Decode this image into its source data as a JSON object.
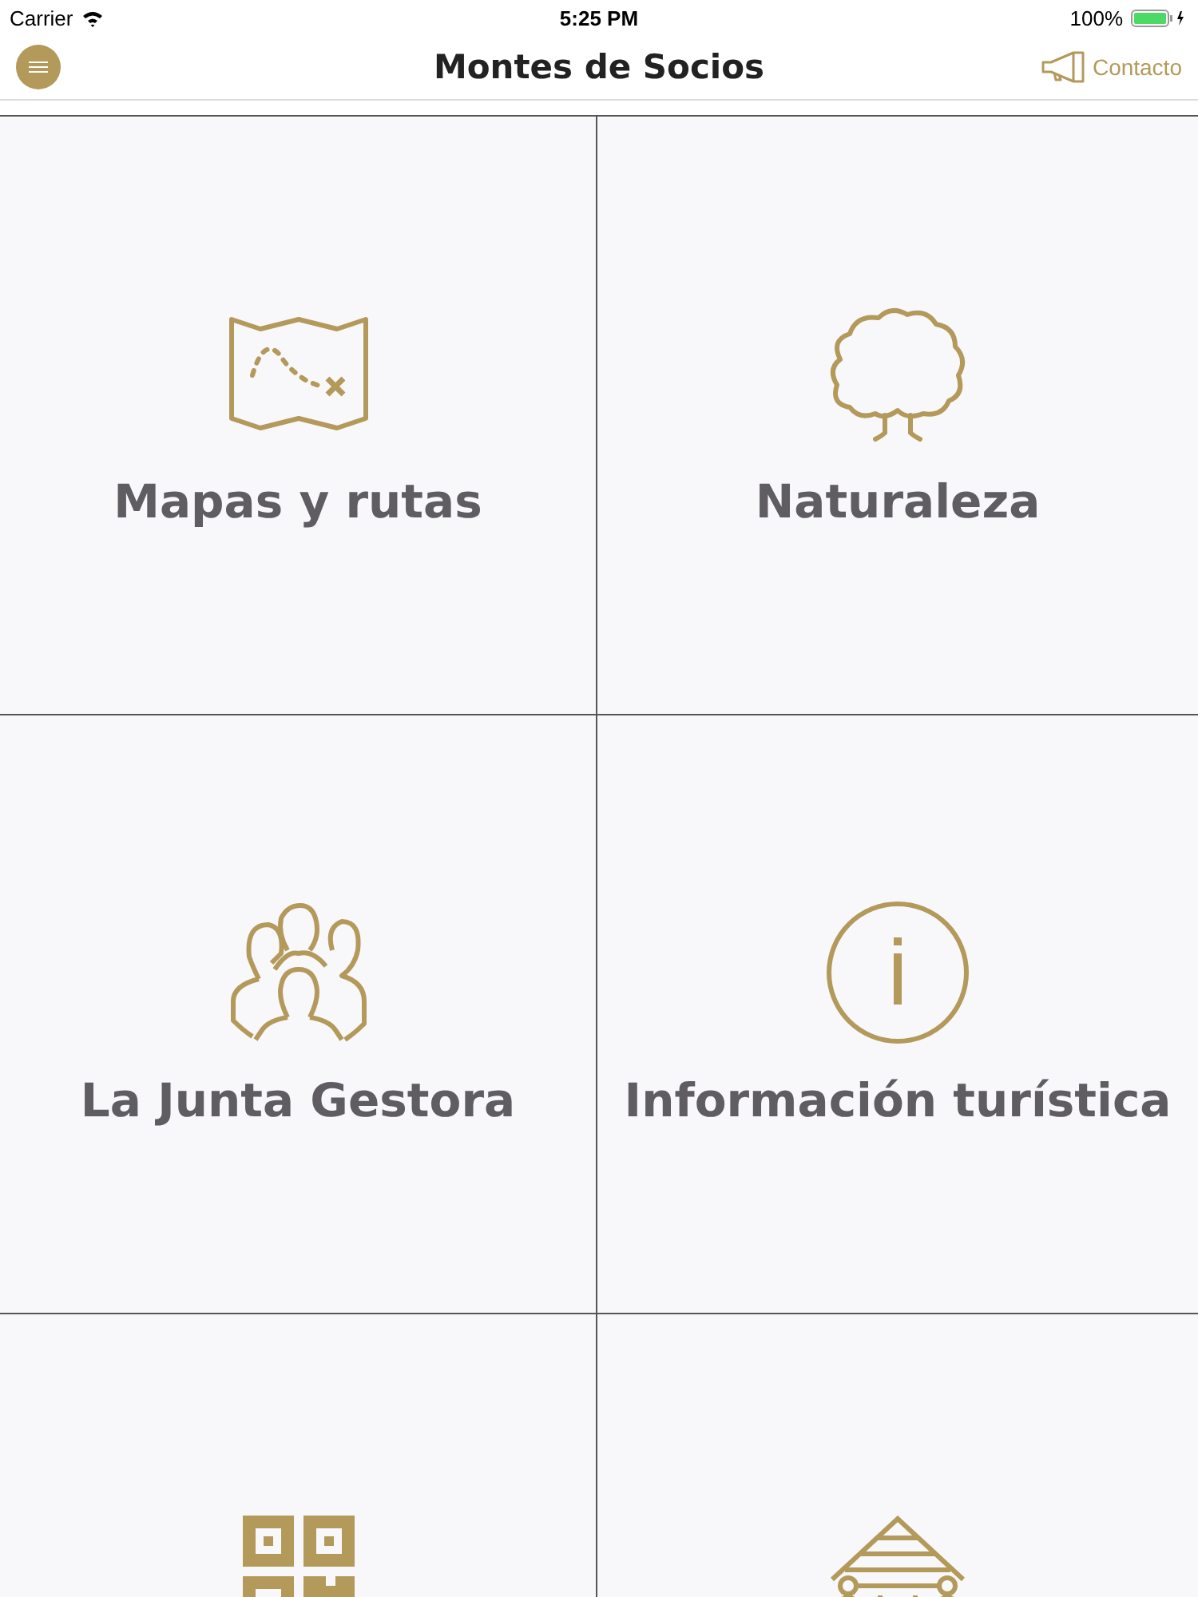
{
  "status_bar": {
    "carrier": "Carrier",
    "time": "5:25 PM",
    "battery": "100%"
  },
  "nav": {
    "title": "Montes de Socios",
    "contact": "Contacto"
  },
  "tiles": [
    {
      "kind": "map",
      "label": "Mapas y rutas"
    },
    {
      "kind": "tree",
      "label": "Naturaleza"
    },
    {
      "kind": "people",
      "label": "La Junta Gestora"
    },
    {
      "kind": "info",
      "label": "Información turística"
    },
    {
      "kind": "qr"
    },
    {
      "kind": "cabin"
    }
  ]
}
